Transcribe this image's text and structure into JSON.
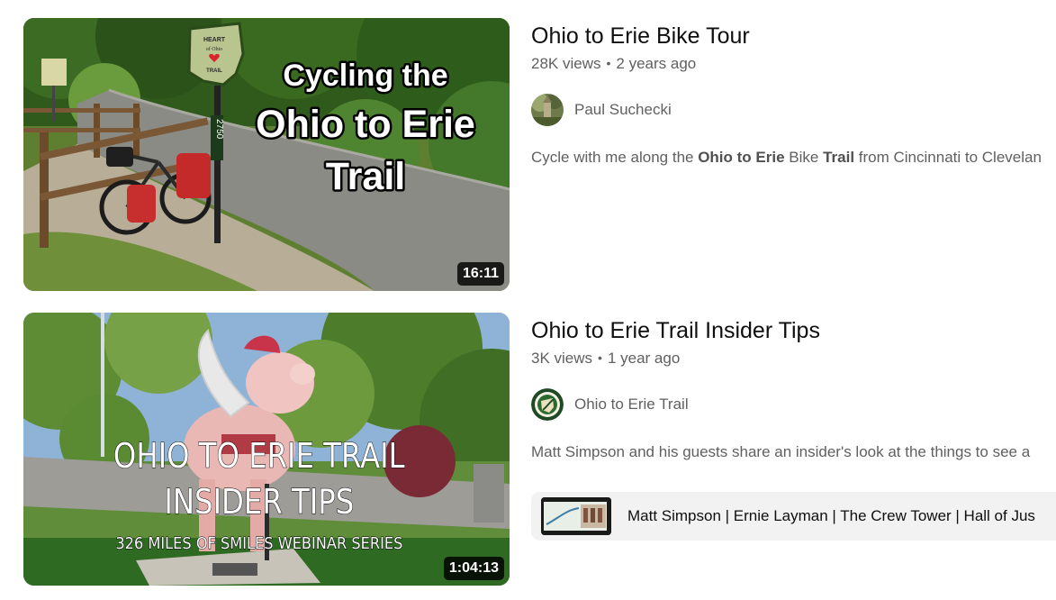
{
  "videos": [
    {
      "title": "Ohio to Erie Bike Tour",
      "views": "28K views",
      "age": "2 years ago",
      "channel": "Paul Suchecki",
      "description_parts": [
        "Cycle with me along the ",
        "Ohio to Erie",
        " Bike ",
        "Trail",
        " from Cincinnati to Clevelan"
      ],
      "duration": "16:11",
      "thumbnail": {
        "overlay_lines": [
          "Cycling the",
          "Ohio to Erie",
          "Trail"
        ],
        "sign_text": [
          "HEART",
          "of Ohio",
          "TRAIL"
        ],
        "post_number": "2750"
      }
    },
    {
      "title": "Ohio to Erie Trail Insider Tips",
      "views": "3K views",
      "age": "1 year ago",
      "channel": "Ohio to Erie Trail",
      "description": "Matt Simpson and his guests share an insider's look at the things to see a",
      "duration": "1:04:13",
      "chapters": "Matt Simpson | Ernie Layman | The Crew Tower | Hall of Jus",
      "thumbnail": {
        "overlay_lines": [
          "OHIO TO ERIE TRAIL",
          "INSIDER TIPS"
        ],
        "series": "326 MILES OF SMILES WEBINAR SERIES"
      }
    }
  ],
  "colors": {
    "title": "#0f0f0f",
    "meta": "#606060",
    "chapter_bg": "#f2f2f2",
    "duration_bg": "#000000"
  }
}
